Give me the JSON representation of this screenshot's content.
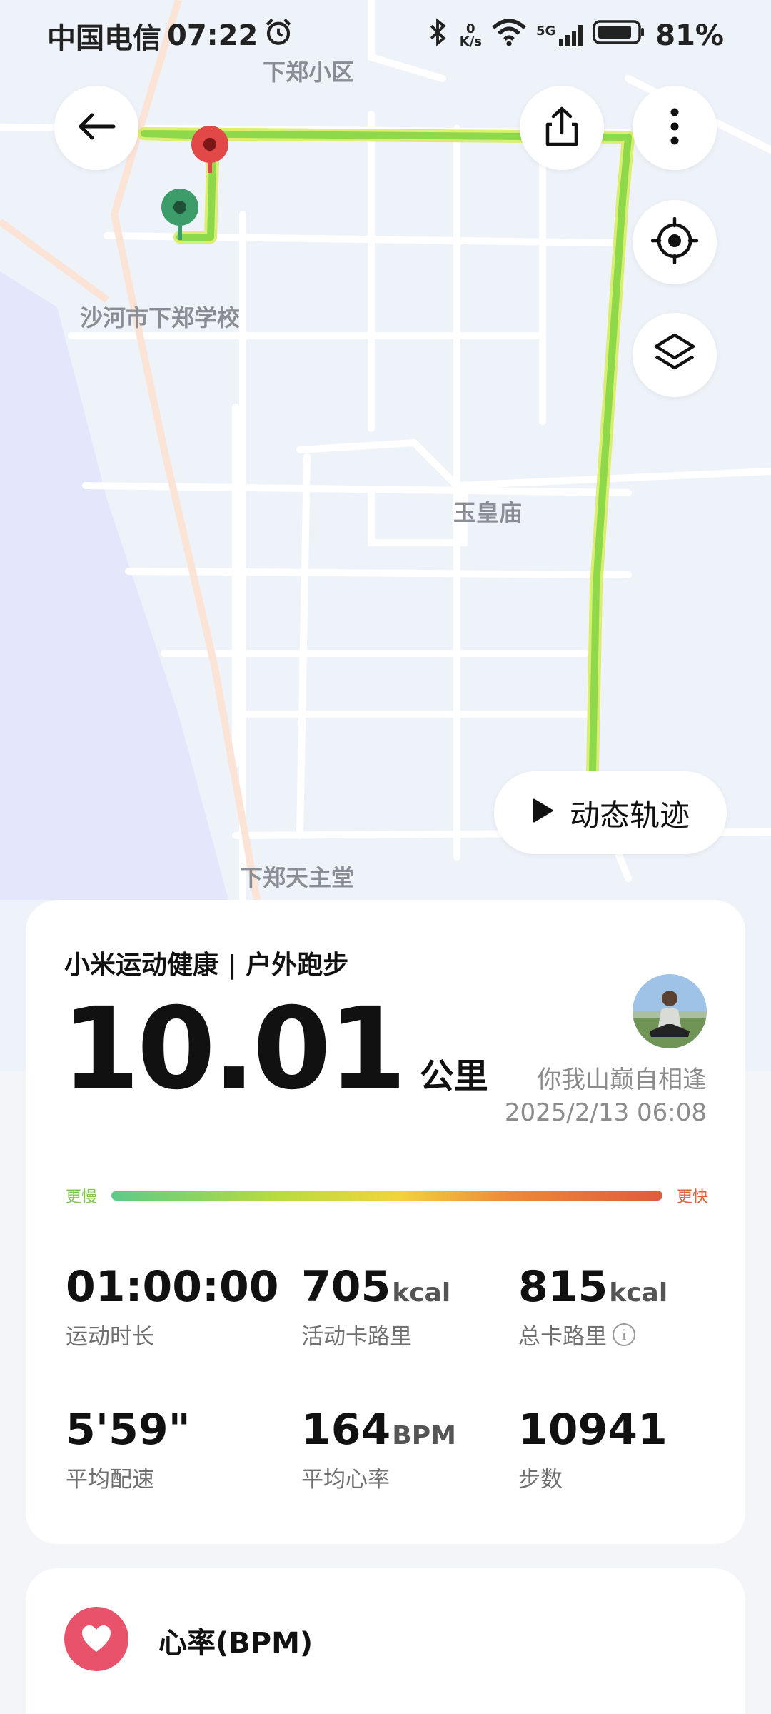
{
  "status_bar": {
    "carrier": "中国电信",
    "time": "07:22",
    "net_speed_value": "0",
    "net_speed_unit": "K/s",
    "signal_label": "5G",
    "battery": "81%"
  },
  "map": {
    "labels": {
      "xiazheng_community": "下郑小区",
      "xiazheng_school": "沙河市下郑学校",
      "yuhuang_temple": "玉皇庙",
      "xiazheng_church": "下郑天主堂"
    },
    "play_button_label": "动态轨迹",
    "route_color": "#8ed94a",
    "start_marker_color": "#3c9c6a",
    "end_marker_color": "#e24848"
  },
  "summary": {
    "brand": "小米运动健康 | 户外跑步",
    "distance_value": "10.01",
    "distance_unit": "公里",
    "username": "你我山巅自相逢",
    "datetime": "2025/2/13 06:08",
    "pace_slow_label": "更慢",
    "pace_fast_label": "更快",
    "stats": [
      {
        "value": "01:00:00",
        "unit": "",
        "label": "运动时长"
      },
      {
        "value": "705",
        "unit": "kcal",
        "label": "活动卡路里"
      },
      {
        "value": "815",
        "unit": "kcal",
        "label": "总卡路里"
      },
      {
        "value": "5'59\"",
        "unit": "",
        "label": "平均配速"
      },
      {
        "value": "164",
        "unit": "BPM",
        "label": "平均心率"
      },
      {
        "value": "10941",
        "unit": "",
        "label": "步数"
      }
    ]
  },
  "heart": {
    "title": "心率(BPM)"
  }
}
